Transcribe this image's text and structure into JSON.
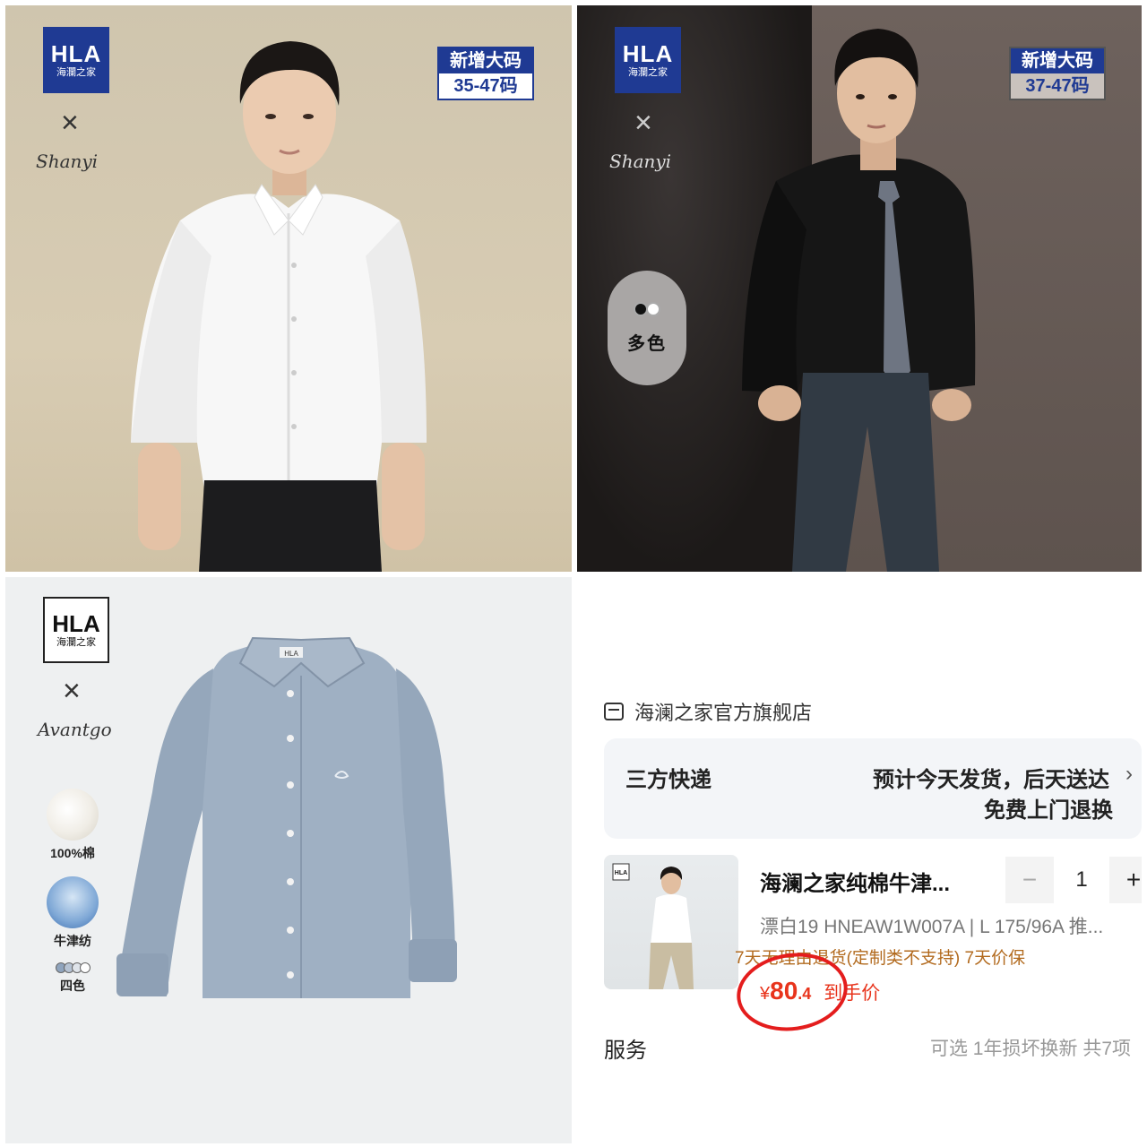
{
  "brand": {
    "logo_text": "HLA",
    "logo_sub": "海瀾之家",
    "cross": "×",
    "collab_signature_1": "Shanyi",
    "collab_signature_2": "Avantgo"
  },
  "panel_white_shirt": {
    "badge_top": "新增大码",
    "badge_bottom": "35-47码"
  },
  "panel_black_shirt": {
    "badge_top": "新增大码",
    "badge_bottom": "37-47码",
    "color_pill_label": "多色",
    "color_dots": [
      "#111111",
      "#ffffff"
    ]
  },
  "panel_blue_shirt": {
    "feature_1": "100%棉",
    "feature_2": "牛津纺",
    "feature_3": "四色",
    "shirt_tag": "HLA"
  },
  "cart": {
    "store_name": "海澜之家官方旗舰店",
    "shipping_label": "三方快递",
    "shipping_line1": "预计今天发货，后天送达",
    "shipping_chevron": "›",
    "shipping_line2": "免费上门退换",
    "product_title": "海澜之家纯棉牛津...",
    "quantity": "1",
    "minus": "−",
    "plus": "+",
    "spec": "漂白19 HNEAW1W007A | L 175/96A 推...",
    "policy": "7天无理由退货(定制类不支持) 7天价保",
    "price_currency": "¥",
    "price_integer": "80",
    "price_decimal": ".4",
    "price_tag": "到手价",
    "service_label": "服务",
    "service_value": "可选 1年损坏换新 共7项"
  },
  "colors": {
    "brand_blue": "#1f3a93",
    "price_red": "#e8341c",
    "circle_red": "#e41d1d",
    "policy_orange": "#b26a1e"
  }
}
